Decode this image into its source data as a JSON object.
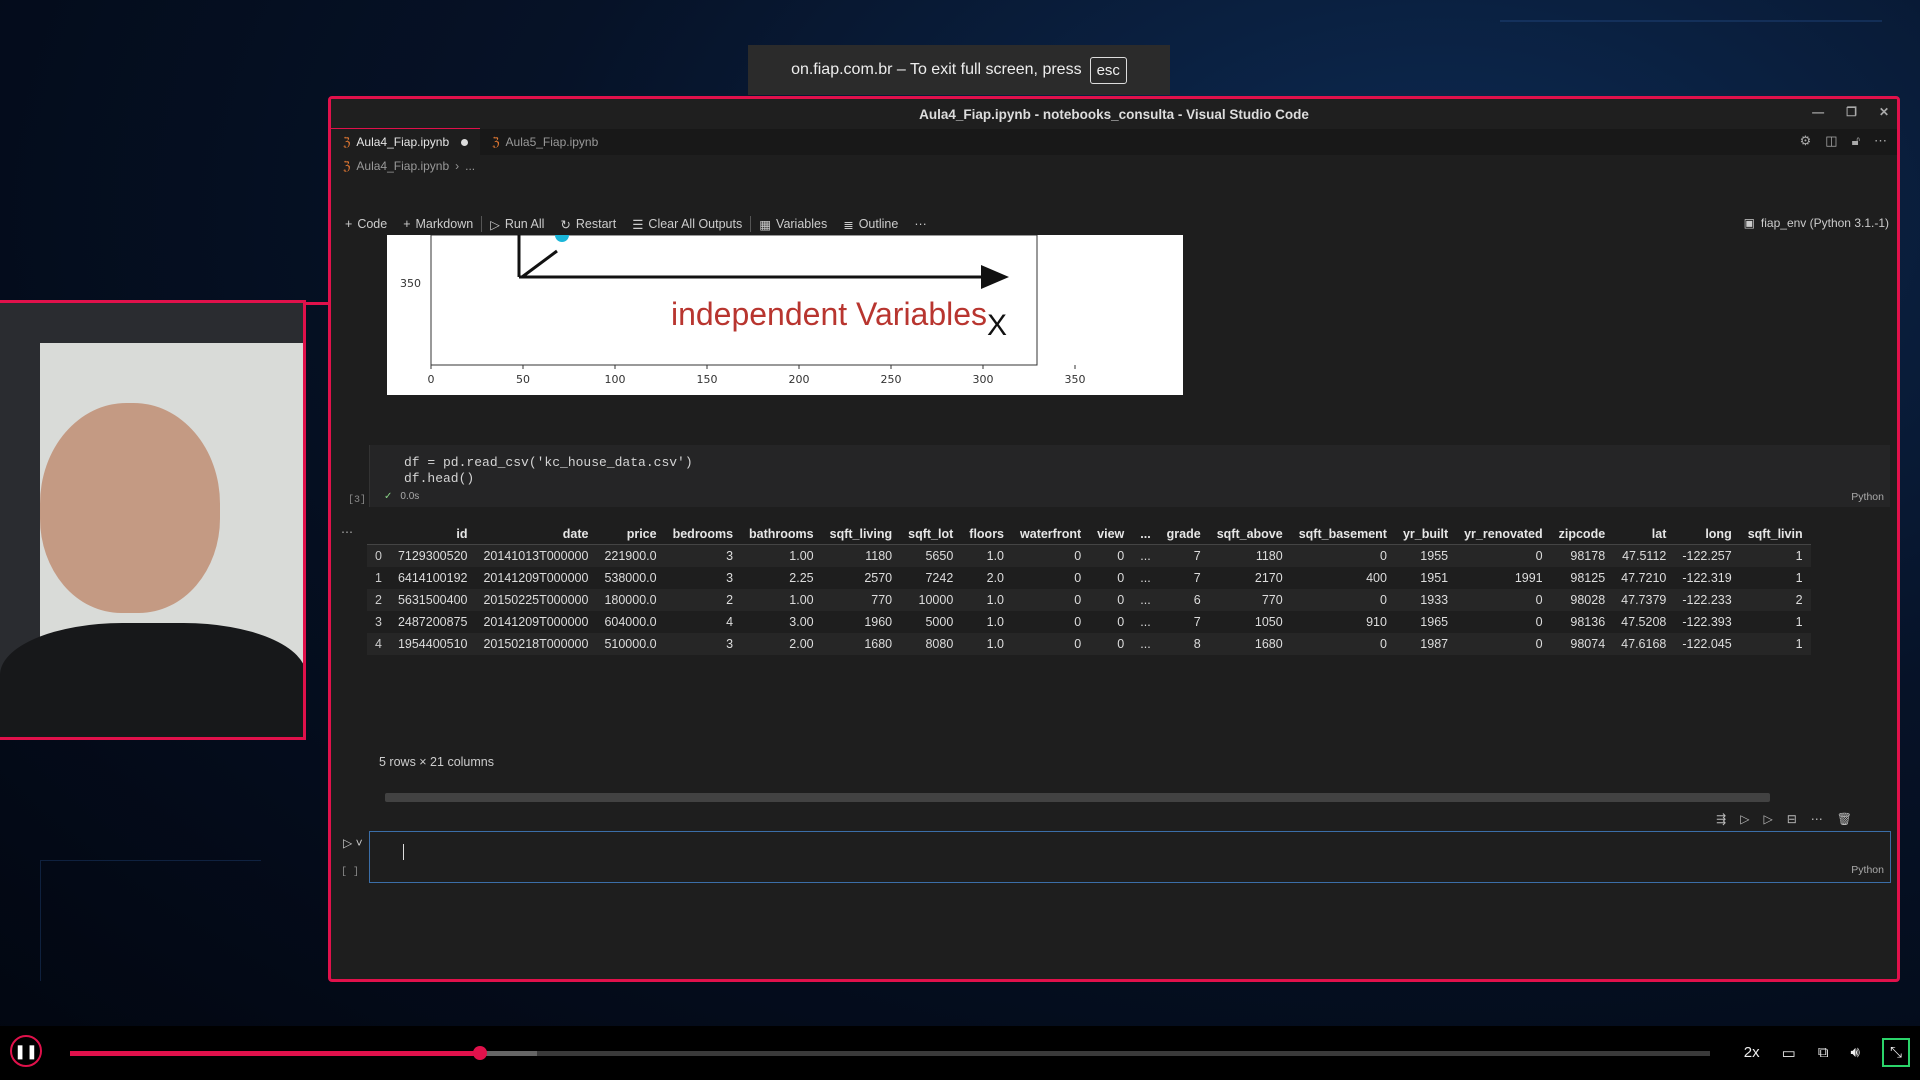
{
  "fullscreen_notice": {
    "text": "on.fiap.com.br – To exit full screen, press",
    "key": "esc"
  },
  "window": {
    "title": "Aula4_Fiap.ipynb - notebooks_consulta - Visual Studio Code"
  },
  "tabs": [
    {
      "label": "Aula4_Fiap.ipynb",
      "active": true,
      "modified": true
    },
    {
      "label": "Aula5_Fiap.ipynb",
      "active": false,
      "modified": false
    }
  ],
  "breadcrumb": {
    "file": "Aula4_Fiap.ipynb",
    "more": "..."
  },
  "toolbar": {
    "code": "Code",
    "markdown": "Markdown",
    "run_all": "Run All",
    "restart": "Restart",
    "clear_outputs": "Clear All Outputs",
    "variables": "Variables",
    "outline": "Outline",
    "more": "···",
    "kernel": "fiap_env (Python 3.1.-1)"
  },
  "plot": {
    "text": "independent Variables",
    "axis_letter": "X",
    "y_tick": "350",
    "x_ticks": [
      "0",
      "50",
      "100",
      "150",
      "200",
      "250",
      "300",
      "350"
    ]
  },
  "code_cell": {
    "lines": [
      "df = pd.read_csv('kc_house_data.csv')",
      "df.head()"
    ],
    "exec_count": "[3]",
    "status_check": "✓",
    "duration": "0.0s",
    "language": "Python"
  },
  "dataframe": {
    "columns": [
      "",
      "id",
      "date",
      "price",
      "bedrooms",
      "bathrooms",
      "sqft_living",
      "sqft_lot",
      "floors",
      "waterfront",
      "view",
      "...",
      "grade",
      "sqft_above",
      "sqft_basement",
      "yr_built",
      "yr_renovated",
      "zipcode",
      "lat",
      "long",
      "sqft_livin"
    ],
    "rows": [
      [
        "0",
        "7129300520",
        "20141013T000000",
        "221900.0",
        "3",
        "1.00",
        "1180",
        "5650",
        "1.0",
        "0",
        "0",
        "...",
        "7",
        "1180",
        "0",
        "1955",
        "0",
        "98178",
        "47.5112",
        "-122.257",
        "1"
      ],
      [
        "1",
        "6414100192",
        "20141209T000000",
        "538000.0",
        "3",
        "2.25",
        "2570",
        "7242",
        "2.0",
        "0",
        "0",
        "...",
        "7",
        "2170",
        "400",
        "1951",
        "1991",
        "98125",
        "47.7210",
        "-122.319",
        "1"
      ],
      [
        "2",
        "5631500400",
        "20150225T000000",
        "180000.0",
        "2",
        "1.00",
        "770",
        "10000",
        "1.0",
        "0",
        "0",
        "...",
        "6",
        "770",
        "0",
        "1933",
        "0",
        "98028",
        "47.7379",
        "-122.233",
        "2"
      ],
      [
        "3",
        "2487200875",
        "20141209T000000",
        "604000.0",
        "4",
        "3.00",
        "1960",
        "5000",
        "1.0",
        "0",
        "0",
        "...",
        "7",
        "1050",
        "910",
        "1965",
        "0",
        "98136",
        "47.5208",
        "-122.393",
        "1"
      ],
      [
        "4",
        "1954400510",
        "20150218T000000",
        "510000.0",
        "3",
        "2.00",
        "1680",
        "8080",
        "1.0",
        "0",
        "0",
        "...",
        "8",
        "1680",
        "0",
        "1987",
        "0",
        "98074",
        "47.6168",
        "-122.045",
        "1"
      ]
    ],
    "shape": "5 rows × 21 columns"
  },
  "empty_cell": {
    "exec_count": "[ ]",
    "language": "Python"
  },
  "video": {
    "progress": 0.25,
    "buffered": 0.285,
    "speed": "2x"
  },
  "colors": {
    "accent": "#e0114b",
    "cell_border": "#3b6ea8"
  }
}
